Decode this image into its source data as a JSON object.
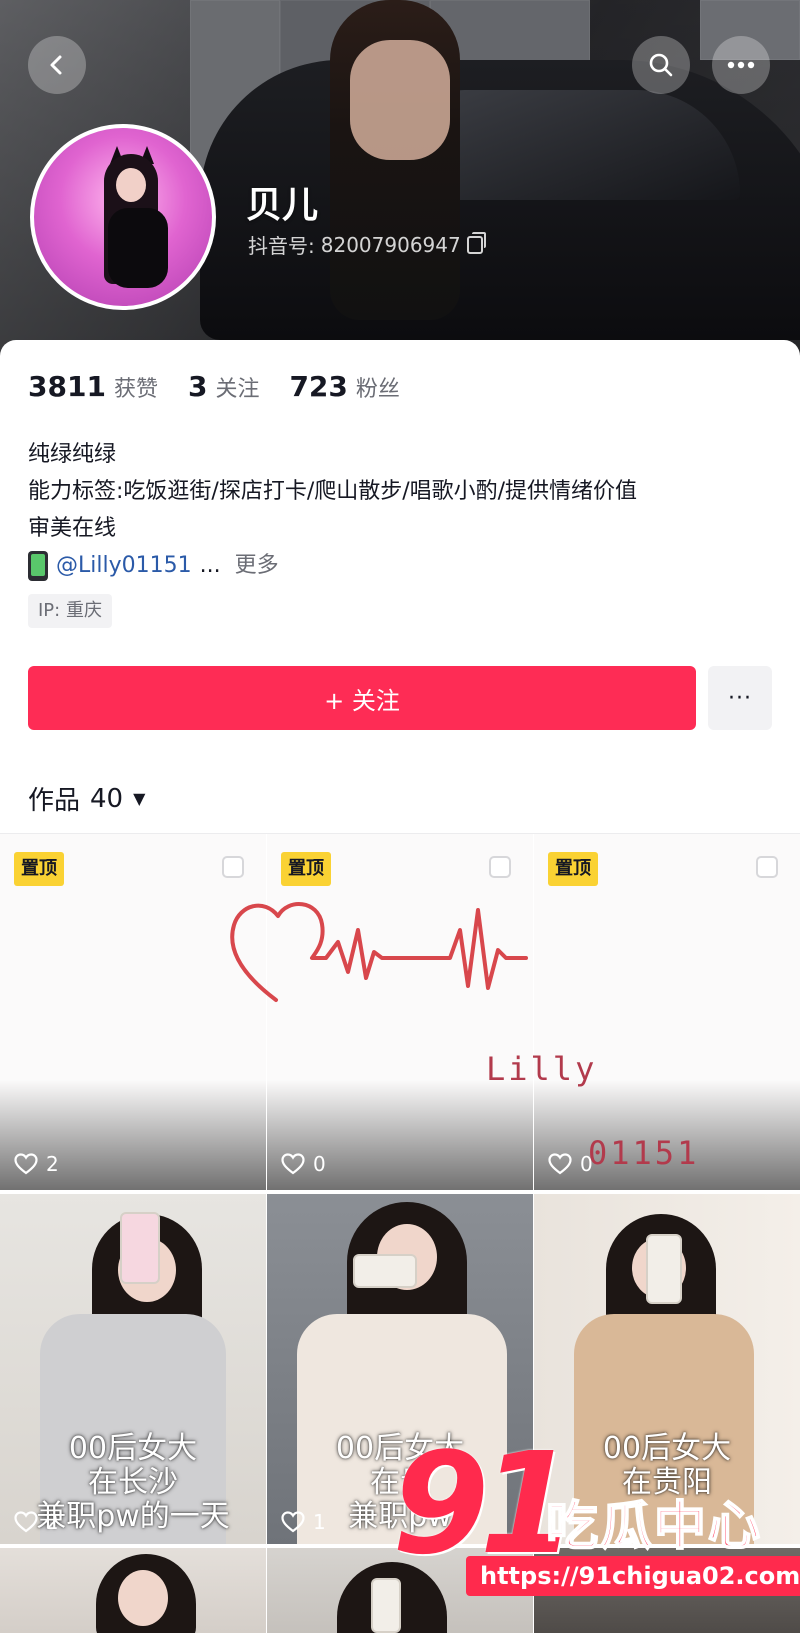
{
  "header": {
    "nickname": "贝儿",
    "douyin_id_label": "抖音号:",
    "douyin_id": "82007906947"
  },
  "stats": [
    {
      "value": "3811",
      "label": "获赞"
    },
    {
      "value": "3",
      "label": "关注"
    },
    {
      "value": "723",
      "label": "粉丝"
    }
  ],
  "bio": {
    "line1": "纯绿纯绿",
    "line2": "能力标签:吃饭逛街/探店打卡/爬山散步/唱歌小酌/提供情绪价值",
    "line3": "审美在线",
    "mention": "@Lilly01151",
    "ellipsis": "...",
    "more": "更多"
  },
  "ip_tag": "IP: 重庆",
  "actions": {
    "follow": "+ 关注",
    "more": "···"
  },
  "works_tab": {
    "label": "作品",
    "count": "40",
    "caret": "▼"
  },
  "pinned_label": "置顶",
  "pinned_tiles": [
    {
      "likes": "2"
    },
    {
      "likes": "0"
    },
    {
      "likes": "0"
    }
  ],
  "pinned_art": {
    "name": "Lilly",
    "code": "01151"
  },
  "video_tiles": [
    {
      "caption_line1": "00后女大",
      "caption_line2": "在长沙",
      "caption_line3": "兼职pw的一天",
      "likes": "2"
    },
    {
      "caption_line1": "00后女大",
      "caption_line2": "在贵",
      "caption_line3": "兼职pw",
      "likes": "1"
    },
    {
      "caption_line1": "00后女大",
      "caption_line2": "在贵阳",
      "caption_line3": "",
      "likes": ""
    }
  ],
  "watermark": {
    "big": "91",
    "cn": "吃瓜中心",
    "url": "https://91chigua02.com"
  },
  "colors": {
    "accent": "#fe2c55",
    "pin_badge": "#fad233",
    "link": "#2b5aa8"
  }
}
